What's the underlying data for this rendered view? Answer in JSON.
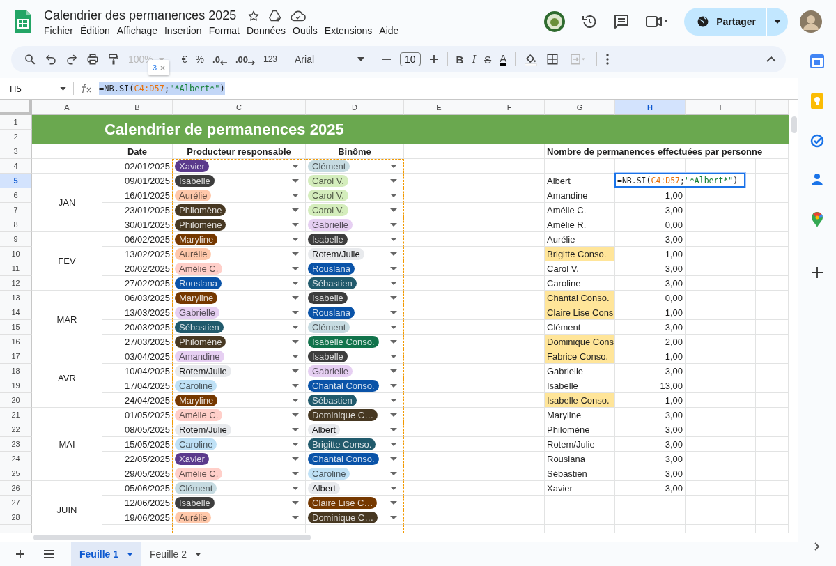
{
  "document": {
    "title": "Calendrier des permanences 2025"
  },
  "menu": [
    "Fichier",
    "Édition",
    "Affichage",
    "Insertion",
    "Format",
    "Données",
    "Outils",
    "Extensions",
    "Aide"
  ],
  "share_button": {
    "label": "Partager"
  },
  "toolbar": {
    "zoom": {
      "label": "100%",
      "disabled": true
    },
    "currency": "€",
    "percent": "%",
    "decrease_decimals": ".0",
    "increase_decimals": ".00",
    "number_format": "123",
    "font": "Arial",
    "font_size": "10",
    "bold": "B",
    "italic": "I",
    "strikethrough": "S",
    "text_color": "A",
    "merge": {
      "disabled": true
    }
  },
  "formula_bar": {
    "cell_ref": "H5",
    "hint": "3",
    "formula": [
      {
        "text": "=NB.SI(",
        "kind": "plain"
      },
      {
        "text": "C4:D57",
        "kind": "range"
      },
      {
        "text": ";",
        "kind": "plain"
      },
      {
        "text": "\"*Albert*\"",
        "kind": "string"
      },
      {
        "text": ")",
        "kind": "plain"
      }
    ]
  },
  "columns": [
    {
      "label": "A",
      "selected": false
    },
    {
      "label": "B",
      "selected": false
    },
    {
      "label": "C",
      "selected": false
    },
    {
      "label": "D",
      "selected": false
    },
    {
      "label": "E",
      "selected": false
    },
    {
      "label": "F",
      "selected": false
    },
    {
      "label": "G",
      "selected": false
    },
    {
      "label": "H",
      "selected": true
    },
    {
      "label": "I",
      "selected": false
    }
  ],
  "rows": [
    {
      "label": "1",
      "selected": false
    },
    {
      "label": "2",
      "selected": false
    },
    {
      "label": "3",
      "selected": false
    },
    {
      "label": "4",
      "selected": false
    },
    {
      "label": "5",
      "selected": true
    },
    {
      "label": "6",
      "selected": false
    },
    {
      "label": "7",
      "selected": false
    },
    {
      "label": "8",
      "selected": false
    },
    {
      "label": "9",
      "selected": false
    },
    {
      "label": "10",
      "selected": false
    },
    {
      "label": "11",
      "selected": false
    },
    {
      "label": "12",
      "selected": false
    },
    {
      "label": "13",
      "selected": false
    },
    {
      "label": "14",
      "selected": false
    },
    {
      "label": "15",
      "selected": false
    },
    {
      "label": "16",
      "selected": false
    },
    {
      "label": "17",
      "selected": false
    },
    {
      "label": "18",
      "selected": false
    },
    {
      "label": "19",
      "selected": false
    },
    {
      "label": "20",
      "selected": false
    },
    {
      "label": "21",
      "selected": false
    },
    {
      "label": "22",
      "selected": false
    },
    {
      "label": "23",
      "selected": false
    },
    {
      "label": "24",
      "selected": false
    },
    {
      "label": "25",
      "selected": false
    },
    {
      "label": "26",
      "selected": false
    },
    {
      "label": "27",
      "selected": false
    },
    {
      "label": "28",
      "selected": false
    }
  ],
  "sheet_title": "Calendrier de permanences 2025",
  "headers": {
    "date": "Date",
    "producer": "Producteur responsable",
    "partner": "Binôme",
    "summary": "Nombre de permanences effectuées par personne"
  },
  "schedule": {
    "first_entry": {
      "date": "02/01/2025",
      "producer": {
        "name": "Xavier",
        "color": "#5b3a8c"
      },
      "partner": {
        "name": "Clément",
        "color": "#c6dbe1"
      }
    },
    "months": [
      {
        "label": "JAN",
        "entries": [
          {
            "date": "09/01/2025",
            "producer": {
              "name": "Isabelle",
              "color": "#3d3d3d"
            },
            "partner": {
              "name": "Carol V.",
              "color": "#d4edbc"
            }
          },
          {
            "date": "16/01/2025",
            "producer": {
              "name": "Aurélie",
              "color": "#ffc8aa"
            },
            "partner": {
              "name": "Carol V.",
              "color": "#d4edbc"
            }
          },
          {
            "date": "23/01/2025",
            "producer": {
              "name": "Philomène",
              "color": "#473822"
            },
            "partner": {
              "name": "Carol V.",
              "color": "#d4edbc"
            }
          },
          {
            "date": "30/01/2025",
            "producer": {
              "name": "Philomène",
              "color": "#473822"
            },
            "partner": {
              "name": "Gabrielle",
              "color": "#e6cff2"
            }
          }
        ]
      },
      {
        "label": "FEV",
        "entries": [
          {
            "date": "06/02/2025",
            "producer": {
              "name": "Maryline",
              "color": "#753800"
            },
            "partner": {
              "name": "Isabelle",
              "color": "#3d3d3d"
            }
          },
          {
            "date": "13/02/2025",
            "producer": {
              "name": "Aurélie",
              "color": "#ffc8aa"
            },
            "partner": {
              "name": "Rotem/Julie",
              "color": "#e8eaed"
            }
          },
          {
            "date": "20/02/2025",
            "producer": {
              "name": "Amélie C.",
              "color": "#ffcfc9"
            },
            "partner": {
              "name": "Rouslana",
              "color": "#0a53a8"
            }
          },
          {
            "date": "27/02/2025",
            "producer": {
              "name": "Rouslana",
              "color": "#0a53a8"
            },
            "partner": {
              "name": "Sébastien",
              "color": "#215a6c"
            }
          }
        ]
      },
      {
        "label": "MAR",
        "entries": [
          {
            "date": "06/03/2025",
            "producer": {
              "name": "Maryline",
              "color": "#753800"
            },
            "partner": {
              "name": "Isabelle",
              "color": "#3d3d3d"
            }
          },
          {
            "date": "13/03/2025",
            "producer": {
              "name": "Gabrielle",
              "color": "#e6cff2"
            },
            "partner": {
              "name": "Rouslana",
              "color": "#0a53a8"
            }
          },
          {
            "date": "20/03/2025",
            "producer": {
              "name": "Sébastien",
              "color": "#215a6c"
            },
            "partner": {
              "name": "Clément",
              "color": "#c6dbe1"
            }
          },
          {
            "date": "27/03/2025",
            "producer": {
              "name": "Philomène",
              "color": "#473822"
            },
            "partner": {
              "name": "Isabelle Conso.",
              "color": "#11734b"
            }
          }
        ]
      },
      {
        "label": "AVR",
        "entries": [
          {
            "date": "03/04/2025",
            "producer": {
              "name": "Amandine",
              "color": "#e6cff2"
            },
            "partner": {
              "name": "Isabelle",
              "color": "#3d3d3d"
            }
          },
          {
            "date": "10/04/2025",
            "producer": {
              "name": "Rotem/Julie",
              "color": "#e8eaed"
            },
            "partner": {
              "name": "Gabrielle",
              "color": "#e6cff2"
            }
          },
          {
            "date": "17/04/2025",
            "producer": {
              "name": "Caroline",
              "color": "#bfe1f6"
            },
            "partner": {
              "name": "Chantal Conso.",
              "color": "#0a53a8"
            }
          },
          {
            "date": "24/04/2025",
            "producer": {
              "name": "Maryline",
              "color": "#753800"
            },
            "partner": {
              "name": "Sébastien",
              "color": "#215a6c"
            }
          }
        ]
      },
      {
        "label": "MAI",
        "entries": [
          {
            "date": "01/05/2025",
            "producer": {
              "name": "Amélie C.",
              "color": "#ffcfc9"
            },
            "partner": {
              "name": "Dominique C…",
              "color": "#473822"
            }
          },
          {
            "date": "08/05/2025",
            "producer": {
              "name": "Rotem/Julie",
              "color": "#e8eaed"
            },
            "partner": {
              "name": "Albert",
              "color": "#e8eaed"
            }
          },
          {
            "date": "15/05/2025",
            "producer": {
              "name": "Caroline",
              "color": "#bfe1f6"
            },
            "partner": {
              "name": "Brigitte Conso.",
              "color": "#215a6c"
            }
          },
          {
            "date": "22/05/2025",
            "producer": {
              "name": "Xavier",
              "color": "#5b3a8c"
            },
            "partner": {
              "name": "Chantal Conso.",
              "color": "#0a53a8"
            }
          },
          {
            "date": "29/05/2025",
            "producer": {
              "name": "Amélie C.",
              "color": "#ffcfc9"
            },
            "partner": {
              "name": "Caroline",
              "color": "#bfe1f6"
            }
          }
        ]
      },
      {
        "label": "JUIN",
        "entries": [
          {
            "date": "05/06/2025",
            "producer": {
              "name": "Clément",
              "color": "#c6dbe1"
            },
            "partner": {
              "name": "Albert",
              "color": "#e8eaed"
            }
          },
          {
            "date": "12/06/2025",
            "producer": {
              "name": "Isabelle",
              "color": "#3d3d3d"
            },
            "partner": {
              "name": "Claire Lise C…",
              "color": "#753800"
            }
          },
          {
            "date": "19/06/2025",
            "producer": {
              "name": "Aurélie",
              "color": "#ffc8aa"
            },
            "partner": {
              "name": "Dominique C…",
              "color": "#473822"
            }
          }
        ]
      }
    ]
  },
  "summary": [
    {
      "name": "Albert",
      "highlighted": false,
      "formula": [
        {
          "text": "=NB.SI(",
          "kind": "plain"
        },
        {
          "text": "C4:D57",
          "kind": "range"
        },
        {
          "text": ";",
          "kind": "plain"
        },
        {
          "text": "\"*Albert*\"",
          "kind": "string"
        },
        {
          "text": ")",
          "kind": "plain"
        }
      ]
    },
    {
      "name": "Amandine",
      "value": "1,00",
      "highlighted": false
    },
    {
      "name": "Amélie C.",
      "value": "3,00",
      "highlighted": false
    },
    {
      "name": "Amélie R.",
      "value": "0,00",
      "highlighted": false
    },
    {
      "name": "Aurélie",
      "value": "3,00",
      "highlighted": false
    },
    {
      "name": "Brigitte Conso.",
      "value": "1,00",
      "highlighted": true
    },
    {
      "name": "Carol V.",
      "value": "3,00",
      "highlighted": false
    },
    {
      "name": "Caroline",
      "value": "3,00",
      "highlighted": false
    },
    {
      "name": "Chantal Conso.",
      "value": "0,00",
      "highlighted": true
    },
    {
      "name": "Claire Lise Cons",
      "value": "1,00",
      "highlighted": true
    },
    {
      "name": "Clément",
      "value": "3,00",
      "highlighted": false
    },
    {
      "name": "Dominique Cons",
      "value": "2,00",
      "highlighted": true
    },
    {
      "name": "Fabrice Conso.",
      "value": "1,00",
      "highlighted": true
    },
    {
      "name": "Gabrielle",
      "value": "3,00",
      "highlighted": false
    },
    {
      "name": "Isabelle",
      "value": "13,00",
      "highlighted": false
    },
    {
      "name": "Isabelle Conso.",
      "value": "1,00",
      "highlighted": true
    },
    {
      "name": "Maryline",
      "value": "3,00",
      "highlighted": false
    },
    {
      "name": "Philomène",
      "value": "3,00",
      "highlighted": false
    },
    {
      "name": "Rotem/Julie",
      "value": "3,00",
      "highlighted": false
    },
    {
      "name": "Rouslana",
      "value": "3,00",
      "highlighted": false
    },
    {
      "name": "Sébastien",
      "value": "3,00",
      "highlighted": false
    },
    {
      "name": "Xavier",
      "value": "3,00",
      "highlighted": false
    }
  ],
  "sheets": [
    {
      "label": "Feuille 1",
      "selected": true
    },
    {
      "label": "Feuille 2",
      "selected": false
    }
  ]
}
